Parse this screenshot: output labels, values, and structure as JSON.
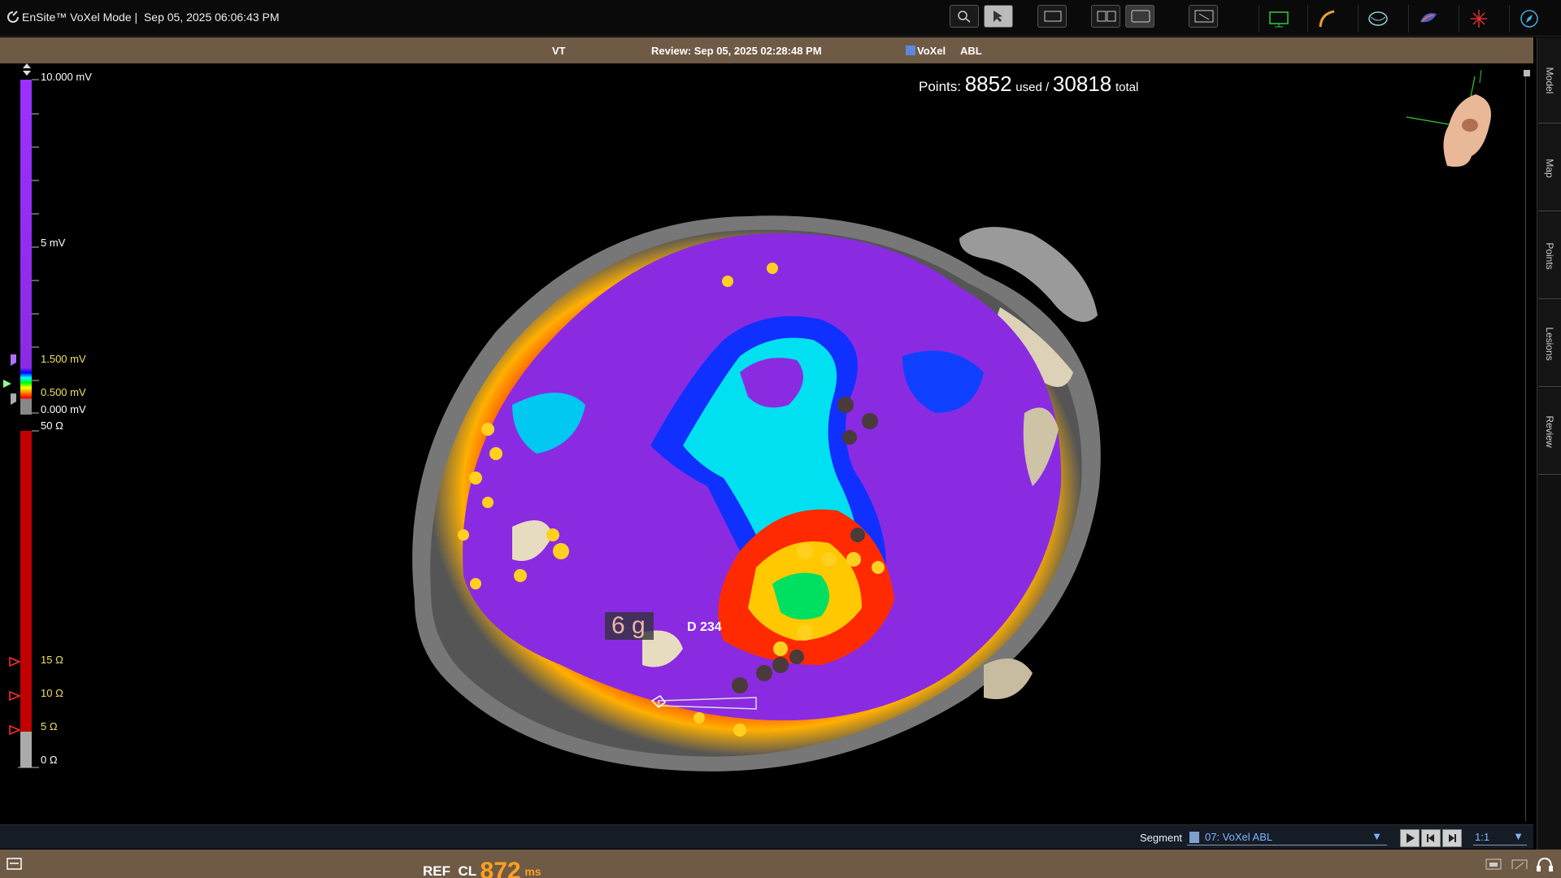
{
  "app": {
    "title": "EnSite™ VoXel Mode |",
    "datetime": "Sep 05, 2025 06:06:43 PM"
  },
  "infobar": {
    "rhythm": "VT",
    "review": "Review: Sep 05, 2025 02:28:48 PM",
    "mode": "VoXel",
    "catheter": "ABL"
  },
  "points": {
    "prefix": "Points:",
    "used": "8852",
    "used_label": "used /",
    "total": "30818",
    "total_label": "total"
  },
  "voltage_scale": {
    "top": "10.000 mV",
    "mid": "5 mV",
    "upper": "1.500 mV",
    "lower": "0.500 mV",
    "zero": "0.000 mV",
    "colors": [
      "#8a2be2",
      "#0000ff",
      "#00ffff",
      "#ffff00",
      "#ff0000",
      "#888888"
    ]
  },
  "impedance_scale": {
    "top": "50 Ω",
    "m15": "15 Ω",
    "m10": "10 Ω",
    "m5": "5 Ω",
    "zero": "0 Ω"
  },
  "right_tabs": [
    "Model",
    "Map",
    "Points",
    "Lesions",
    "Review"
  ],
  "overlay": {
    "force": "6 g",
    "catheter_label": "D 234"
  },
  "segment": {
    "label": "Segment",
    "value": "07: VoXel ABL",
    "ratio": "1:1"
  },
  "status": {
    "ref": "REF",
    "cl": "CL",
    "value": "872",
    "unit": "ms"
  },
  "colors": {
    "infobar": "#6e5a45",
    "accent": "#ffa020",
    "scale_label_yellow": "#f0e060",
    "map_purple": "#8a2be2"
  }
}
